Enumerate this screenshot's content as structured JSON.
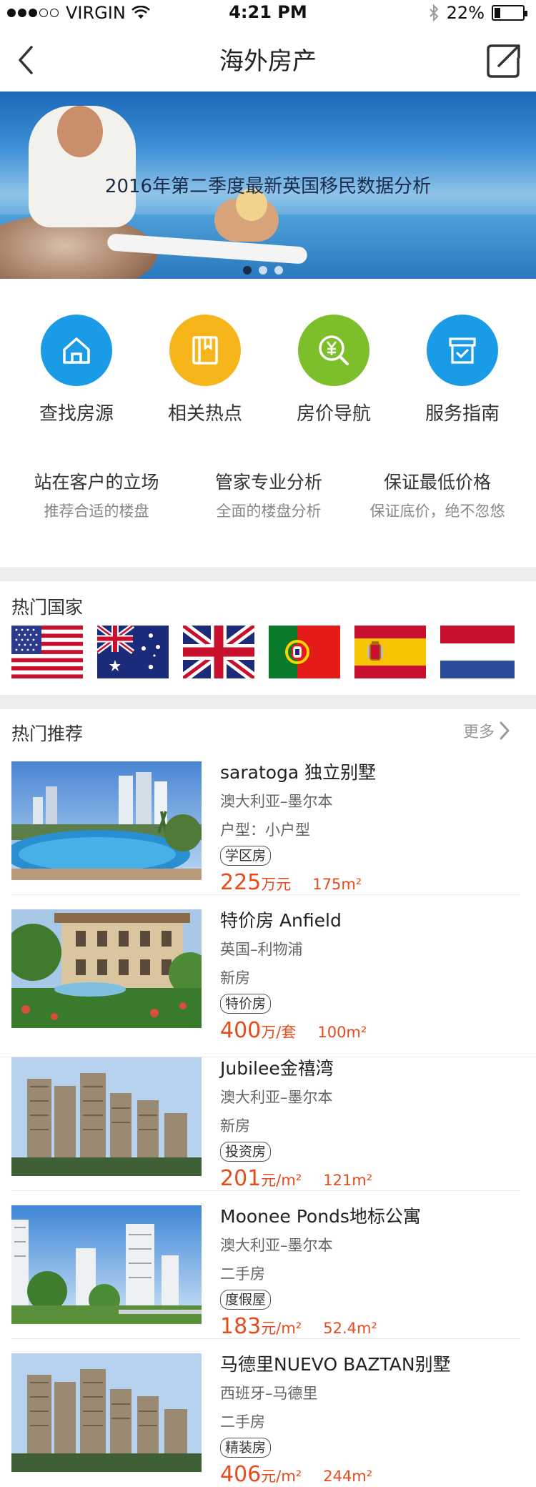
{
  "status_bar": {
    "carrier": "VIRGIN",
    "time": "4:21 PM",
    "battery": "22%",
    "battery_level": 0.22
  },
  "nav": {
    "title": "海外房产"
  },
  "banner": {
    "caption": "2016年第二季度最新英国移民数据分析",
    "slide_count": 3,
    "active_slide": 1
  },
  "quick_menu": [
    {
      "label": "查找房源",
      "icon": "house-icon",
      "color": "#1a9be6"
    },
    {
      "label": "相关热点",
      "icon": "bookmark-icon",
      "color": "#f5b51b"
    },
    {
      "label": "房价导航",
      "icon": "yen-search-icon",
      "color": "#7cbf2a"
    },
    {
      "label": "服务指南",
      "icon": "archive-check-icon",
      "color": "#1a9be6"
    }
  ],
  "features": [
    {
      "title": "站在客户的立场",
      "subtitle": "推荐合适的楼盘"
    },
    {
      "title": "管家专业分析",
      "subtitle": "全面的楼盘分析"
    },
    {
      "title": "保证最低价格",
      "subtitle": "保证底价，绝不忽悠"
    }
  ],
  "countries": {
    "title": "热门国家",
    "flags": [
      "usa-flag",
      "australia-flag",
      "uk-flag",
      "portugal-flag",
      "spain-flag",
      "netherlands-flag"
    ]
  },
  "recommend": {
    "title": "热门推荐",
    "more": "更多",
    "listings": [
      {
        "title": "saratoga 独立别墅",
        "location": "澳大利亚–墨尔本",
        "type": "户型：小户型",
        "tag": "学区房",
        "price": "225",
        "unit": "万元",
        "area": "175m²",
        "image": "pool-resort-image"
      },
      {
        "title": "特价房 Anfield",
        "location": "英国–利物浦",
        "type": "新房",
        "tag": "特价房",
        "price": "400",
        "unit": "万/套",
        "area": "100m²",
        "image": "villa-garden-image"
      },
      {
        "title": "Jubilee金禧湾",
        "location": "澳大利亚–墨尔本",
        "type": "新房",
        "tag": "投资房",
        "price": "201",
        "unit": "元/m²",
        "area": "121m²",
        "image": "apartment-towers-image"
      },
      {
        "title": "Moonee Ponds地标公寓",
        "location": "澳大利亚–墨尔本",
        "type": "二手房",
        "tag": "度假屋",
        "price": "183",
        "unit": "元/m²",
        "area": "52.4m²",
        "image": "white-towers-image"
      },
      {
        "title": "马德里NUEVO BAZTAN别墅",
        "location": "西班牙–马德里",
        "type": "二手房",
        "tag": "精装房",
        "price": "406",
        "unit": "元/m²",
        "area": "244m²",
        "image": "apartment-towers-image"
      }
    ]
  }
}
